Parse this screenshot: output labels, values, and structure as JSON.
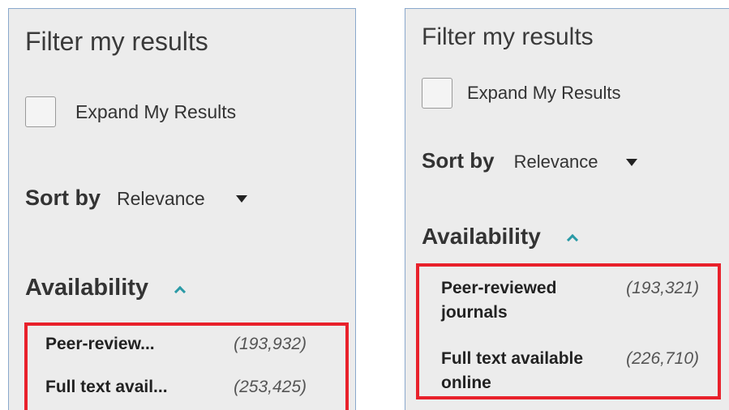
{
  "panels": [
    {
      "title": "Filter my results",
      "expand_label": "Expand My Results",
      "sort_label": "Sort by",
      "sort_value": "Relevance",
      "availability_title": "Availability",
      "facets": [
        {
          "name": "Peer-review...",
          "count": "(193,932)"
        },
        {
          "name": "Full text avail...",
          "count": "(253,425)"
        }
      ]
    },
    {
      "title": "Filter my results",
      "expand_label": "Expand My Results",
      "sort_label": "Sort by",
      "sort_value": "Relevance",
      "availability_title": "Availability",
      "facets": [
        {
          "name": "Peer-reviewed journals",
          "count": "(193,321)"
        },
        {
          "name": "Full text available online",
          "count": "(226,710)"
        }
      ]
    }
  ],
  "colors": {
    "panel_background": "#ececec",
    "panel_border": "#8aa8cc",
    "highlight_border": "#e8212b",
    "chevron_accent": "#2a9aa6"
  },
  "icons": {
    "sort_dropdown": "caret-down-icon",
    "availability_toggle": "chevron-up-icon"
  }
}
